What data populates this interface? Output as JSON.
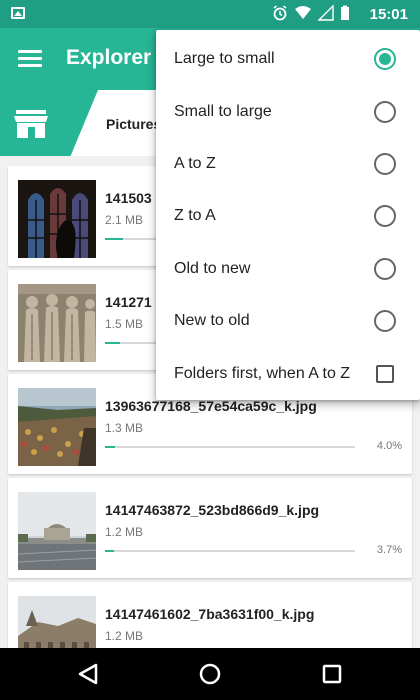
{
  "status_bar": {
    "time": "15:01"
  },
  "toolbar": {
    "title": "Explorer"
  },
  "breadcrumb": {
    "label": "Pictures"
  },
  "files": [
    {
      "name": "141503",
      "size": "2.1 MB",
      "progress": 0.07,
      "percent": ""
    },
    {
      "name": "141271",
      "size": "1.5 MB",
      "progress": 0.06,
      "percent": ""
    },
    {
      "name": "13963677168_57e54ca59c_k.jpg",
      "size": "1.3 MB",
      "progress": 0.04,
      "percent": "4.0%"
    },
    {
      "name": "14147463872_523bd866d9_k.jpg",
      "size": "1.2 MB",
      "progress": 0.037,
      "percent": "3.7%"
    },
    {
      "name": "14147461602_7ba3631f00_k.jpg",
      "size": "1.2 MB",
      "progress": 0,
      "percent": ""
    }
  ],
  "sort_menu": {
    "options": [
      {
        "label": "Large to small",
        "selected": true
      },
      {
        "label": "Small to large",
        "selected": false
      },
      {
        "label": "A to Z",
        "selected": false
      },
      {
        "label": "Z to A",
        "selected": false
      },
      {
        "label": "Old to new",
        "selected": false
      },
      {
        "label": "New to old",
        "selected": false
      }
    ],
    "folders_first": {
      "label": "Folders first, when A to Z",
      "checked": false
    }
  },
  "colors": {
    "primary": "#26b595",
    "status_bar": "#1f9e84"
  }
}
